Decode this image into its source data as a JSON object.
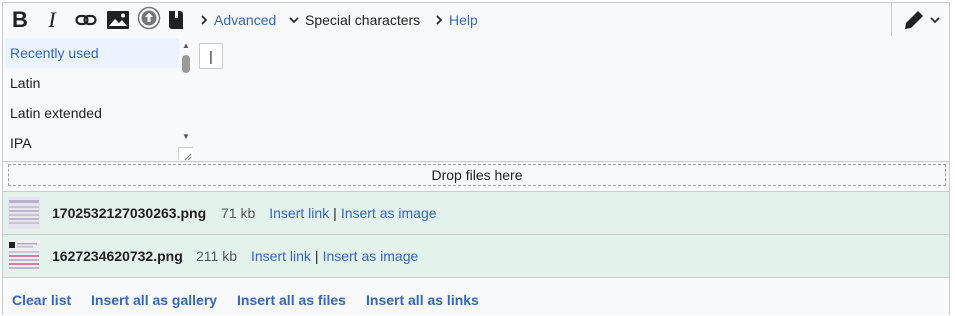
{
  "toolbar": {
    "bold_label": "B",
    "italic_label": "I",
    "tabs": [
      {
        "label": "Advanced"
      },
      {
        "label": "Special characters"
      },
      {
        "label": "Help"
      }
    ]
  },
  "special_characters": {
    "categories": [
      "Recently used",
      "Latin",
      "Latin extended",
      "IPA"
    ],
    "selected_index": 0,
    "preview_char": "|"
  },
  "dropzone": {
    "label": "Drop files here"
  },
  "files": [
    {
      "name": "1702532127030263.png",
      "size": "71 kb",
      "insert_link": "Insert link",
      "separator": "|",
      "insert_image": "Insert as image"
    },
    {
      "name": "1627234620732.png",
      "size": "211 kb",
      "insert_link": "Insert link",
      "separator": "|",
      "insert_image": "Insert as image"
    }
  ],
  "actions": {
    "clear": "Clear list",
    "gallery": "Insert all as gallery",
    "files": "Insert all as files",
    "links": "Insert all as links"
  },
  "colors": {
    "link": "#3366cc",
    "uploaded_row": "#e4f2ec",
    "selected_category": "#eaf3ff"
  }
}
